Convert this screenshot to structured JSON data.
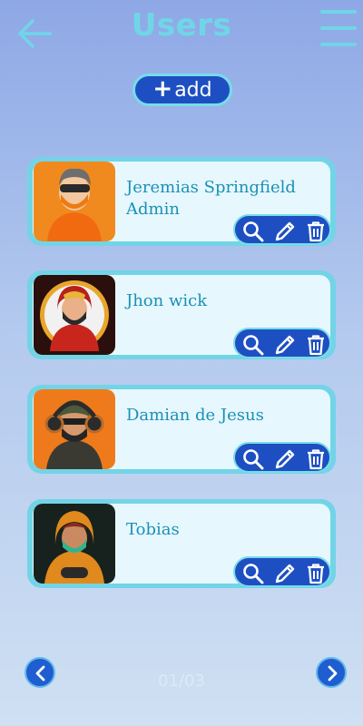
{
  "header": {
    "title": "Users",
    "back_icon": "arrow-left-icon",
    "menu_icon": "hamburger-menu-icon"
  },
  "add_button": {
    "label": "add",
    "icon": "plus-icon"
  },
  "users": [
    {
      "name": "Jeremias Springfield",
      "role": "Admin"
    },
    {
      "name": "Jhon wick",
      "role": ""
    },
    {
      "name": "Damian de Jesus",
      "role": ""
    },
    {
      "name": "Tobias",
      "role": ""
    }
  ],
  "row_actions": [
    "search-icon",
    "pencil-icon",
    "trash-icon"
  ],
  "pagination": {
    "label": "01/03",
    "prev_icon": "chevron-left-icon",
    "next_icon": "chevron-right-icon"
  },
  "colors": {
    "accent": "#1e4fc2",
    "title": "#6fd6e8",
    "card_border": "#72d4e6",
    "name_text": "#1c8fb8"
  }
}
